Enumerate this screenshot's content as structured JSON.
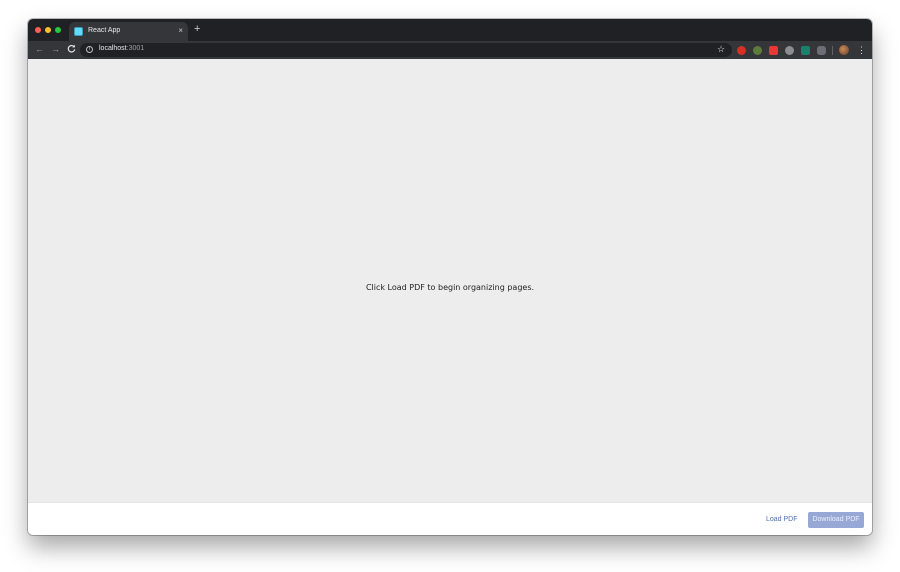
{
  "browser": {
    "tab": {
      "title": "React App",
      "close": "×",
      "favicon": "react-favicon"
    },
    "new_tab": "+",
    "nav": {
      "back": "←",
      "forward": "→",
      "reload": "C"
    },
    "address_bar": {
      "host": "localhost",
      "port": ":3001",
      "info": "i"
    },
    "star": "☆",
    "menu": "⋮",
    "extensions": [
      "red-extension-icon",
      "green-extension-icon",
      "pdf-extension-icon",
      "gray-extension-icon",
      "s-extension-icon",
      "grid-extension-icon"
    ]
  },
  "app": {
    "empty_message": "Click Load PDF to begin organizing pages.",
    "footer": {
      "load_label": "Load PDF",
      "download_label": "Download PDF"
    }
  },
  "colors": {
    "accent": "#97a8d6",
    "link": "#4a6fb5",
    "content_background": "#ededed"
  }
}
